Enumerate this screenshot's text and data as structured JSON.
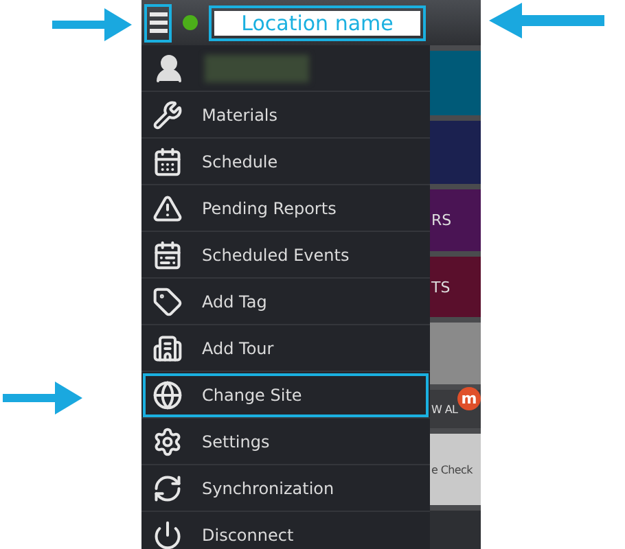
{
  "header": {
    "menu_highlighted": true,
    "online": true,
    "location_name": "Location name",
    "location_highlighted": true
  },
  "user": {
    "kind": "blurred"
  },
  "menu": [
    {
      "kind": "materials",
      "label": "Materials",
      "highlighted": false
    },
    {
      "kind": "schedule",
      "label": "Schedule",
      "highlighted": false
    },
    {
      "kind": "pending",
      "label": "Pending Reports",
      "highlighted": false
    },
    {
      "kind": "events",
      "label": "Scheduled Events",
      "highlighted": false
    },
    {
      "kind": "tag",
      "label": "Add Tag",
      "highlighted": false
    },
    {
      "kind": "tour",
      "label": "Add Tour",
      "highlighted": false
    },
    {
      "kind": "site",
      "label": "Change Site",
      "highlighted": true
    },
    {
      "kind": "settings",
      "label": "Settings",
      "highlighted": false
    },
    {
      "kind": "sync",
      "label": "Synchronization",
      "highlighted": false
    },
    {
      "kind": "power",
      "label": "Disconnect",
      "highlighted": false
    }
  ],
  "tiles": [
    {
      "color": "#005a78"
    },
    {
      "color": "#1b2150"
    },
    {
      "color": "#4a1454",
      "text": "RS"
    },
    {
      "color": "#5a0f2c",
      "text": "TS"
    },
    {
      "color": "#8a8a8a"
    },
    {
      "color": "#3a3b3e",
      "text": "W AL",
      "badge": "m"
    },
    {
      "color": "#c9c9c9",
      "text": "e Check"
    },
    {
      "color": "#2d2f33"
    }
  ]
}
